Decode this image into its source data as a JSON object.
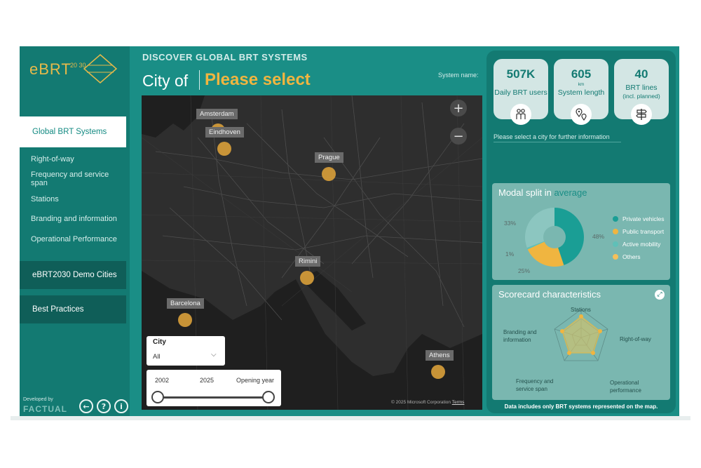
{
  "logo": {
    "text": "eBRT",
    "sub": "20 30"
  },
  "sidebar": {
    "active": "Global BRT Systems",
    "subitems": [
      "Right-of-way",
      "Frequency and service span",
      "Stations",
      "Branding and information",
      "Operational Performance"
    ],
    "blocks": [
      "eBRT2030 Demo Cities",
      "Best Practices"
    ],
    "developed_by": "Developed by",
    "company": "FACTUAL",
    "icons": [
      "back-arrow-icon",
      "help-icon",
      "info-icon"
    ]
  },
  "header": {
    "top": "DISCOVER GLOBAL BRT SYSTEMS",
    "city_of": "City of",
    "city_value": "Please select",
    "system_name_label": "System name:"
  },
  "map": {
    "zoom_in": "+",
    "zoom_out": "−",
    "cities": [
      "Amsterdam",
      "Eindhoven",
      "Prague",
      "Rimini",
      "Barcelona",
      "Athens"
    ],
    "copyright": "© 2025 Microsoft Corporation",
    "terms": "Terms"
  },
  "filters": {
    "city_label": "City",
    "city_value": "All",
    "year_from": "2002",
    "year_to": "2025",
    "year_label": "Opening year"
  },
  "kpis": [
    {
      "value": "507K",
      "unit": "",
      "label": "Daily BRT users",
      "label2": "",
      "icon": "people-icon"
    },
    {
      "value": "605",
      "unit": "km",
      "label": "System length",
      "label2": "",
      "icon": "map-pins-icon"
    },
    {
      "value": "40",
      "unit": "",
      "label": "BRT lines",
      "label2": "(incl. planned)",
      "icon": "signpost-icon"
    }
  ],
  "select_message": "Please select a city for further information",
  "modal_split": {
    "title": "Modal split in",
    "title_accent": "average",
    "legend": [
      "Private vehicles",
      "Public transport",
      "Active mobility",
      "Others"
    ],
    "colors": [
      "#1a9e95",
      "#f0b540",
      "#5fc0b8",
      "#f5c05a"
    ],
    "slices": [
      48,
      25,
      1,
      33
    ],
    "labels": [
      "48%",
      "25%",
      "1%",
      "33%"
    ]
  },
  "scorecard": {
    "title": "Scorecard characteristics",
    "axes": [
      "Stations",
      "Right-of-way",
      "Operational performance",
      "Frequency and service span",
      "Branding and information"
    ]
  },
  "footnote": "Data includes only BRT systems represented on the map."
}
